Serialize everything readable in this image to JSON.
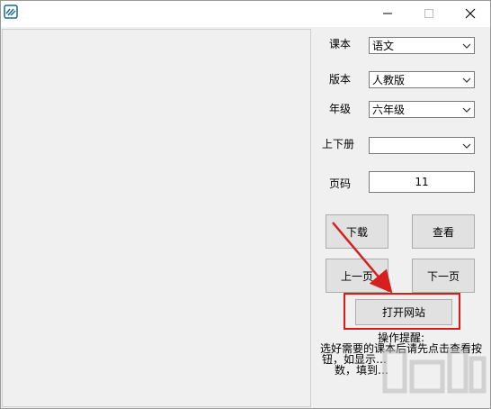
{
  "window": {
    "app_icon": "book-icon",
    "minimize_icon": "minimize-icon",
    "maximize_icon": "maximize-icon",
    "close_icon": "close-icon"
  },
  "form": {
    "subject": {
      "label": "课本",
      "value": "语文"
    },
    "edition": {
      "label": "版本",
      "value": "人教版"
    },
    "grade": {
      "label": "年级",
      "value": "六年级"
    },
    "volume": {
      "label": "上下册",
      "value": ""
    },
    "page": {
      "label": "页码",
      "value": "11"
    }
  },
  "buttons": {
    "download": "下载",
    "view": "查看",
    "prev_page": "上一页",
    "next_page": "下一页",
    "open_website": "打开网站"
  },
  "tips": {
    "title": "操作提醒:",
    "line1": "选好需要的课本后请先点击查看按",
    "line2": "钮，如显示…",
    "line3": "数，填到…"
  },
  "colors": {
    "highlight": "#e01818",
    "window_bg": "#f0f0f0",
    "button_bg": "#e1e1e1"
  }
}
